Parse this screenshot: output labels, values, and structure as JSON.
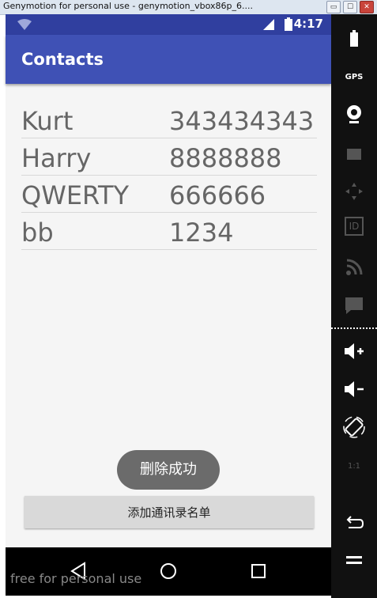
{
  "window": {
    "title": "Genymotion for personal use - genymotion_vbox86p_6....",
    "buttons": [
      "▭",
      "☐",
      "✕"
    ]
  },
  "status_bar": {
    "time": "4:17",
    "icons": [
      "wifi-icon",
      "signal-icon",
      "battery-icon"
    ]
  },
  "app_bar": {
    "title": "Contacts"
  },
  "contacts": [
    {
      "name": "Kurt",
      "phone": "343434343"
    },
    {
      "name": "Harry",
      "phone": "8888888"
    },
    {
      "name": "QWERTY",
      "phone": "666666"
    },
    {
      "name": "bb",
      "phone": "1234"
    }
  ],
  "toast": {
    "text": "删除成功"
  },
  "actions": {
    "add_button_label": "添加通讯录名单"
  },
  "watermark": "free for personal use",
  "sidebar": {
    "items": [
      "battery-icon",
      "gps-icon",
      "webcam-icon",
      "screencast-icon",
      "dpad-icon",
      "id-icon",
      "rss-icon",
      "sms-icon",
      "volume-up-icon",
      "volume-down-icon",
      "rotate-icon",
      "scale-icon",
      "back-icon",
      "menu-icon"
    ],
    "gps_label": "GPS",
    "id_label": "ID",
    "scale_label": "1:1"
  },
  "colors": {
    "status_bar": "#303f9f",
    "app_bar": "#3f51b5",
    "toast": "#6b6b6b"
  }
}
